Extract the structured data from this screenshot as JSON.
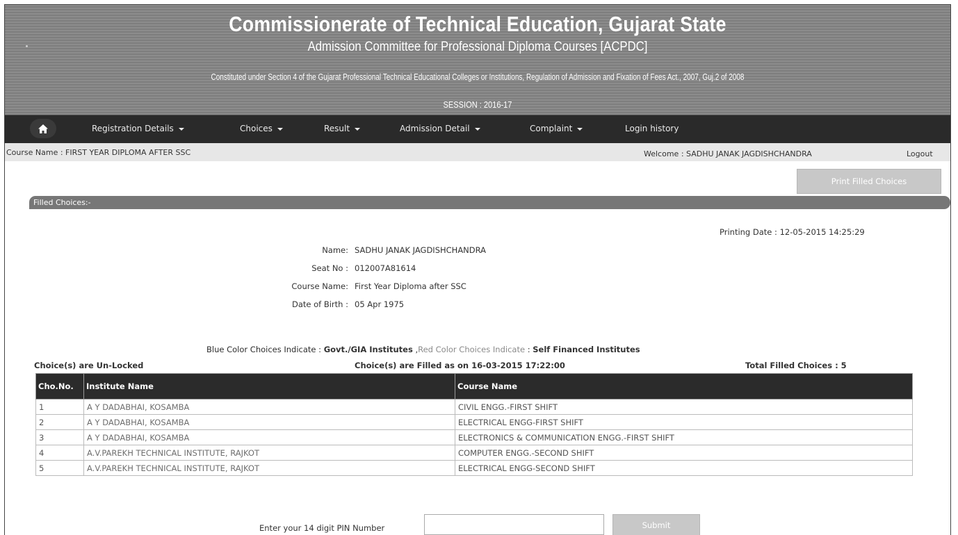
{
  "header": {
    "title": "Commissionerate of Technical Education, Gujarat State",
    "subtitle": "Admission Committee for Professional Diploma Courses [ACPDC]",
    "act": "Constituted under Section 4 of the Gujarat Professional Technical Educational Colleges or Institutions, Regulation of Admission and Fixation of Fees Act., 2007, Guj.2 of 2008",
    "session": "SESSION : 2016-17"
  },
  "nav": {
    "home_icon": "home-icon",
    "items": [
      {
        "label": "Registration Details",
        "dropdown": true
      },
      {
        "label": "Choices",
        "dropdown": true
      },
      {
        "label": "Result",
        "dropdown": true
      },
      {
        "label": "Admission Detail",
        "dropdown": true
      },
      {
        "label": "Complaint",
        "dropdown": true
      },
      {
        "label": "Login history",
        "dropdown": false
      }
    ]
  },
  "infobar": {
    "course": "Course Name : FIRST YEAR DIPLOMA AFTER SSC",
    "welcome": "Welcome : SADHU JANAK JAGDISHCHANDRA",
    "logout": "Logout"
  },
  "print_button": "Print Filled Choices",
  "section_title": "Filled Choices:-",
  "printing_date": "Printing Date : 12-05-2015 14:25:29",
  "candidate": {
    "name_label": "Name:",
    "name": "SADHU JANAK JAGDISHCHANDRA",
    "seat_label": "Seat No :",
    "seat": "012007A81614",
    "course_label": "Course Name:",
    "course": "First Year Diploma after SSC",
    "dob_label": "Date of Birth :",
    "dob": "05 Apr 1975"
  },
  "legend": {
    "blue_text": "Blue Color Choices Indicate",
    "blue_value": "Govt./GIA Institutes",
    "red_text": "Red Color Choices Indicate",
    "red_value": "Self Financed Institutes"
  },
  "status": {
    "locked": "Choice(s) are Un-Locked",
    "filled_on": "Choice(s) are Filled as on 16-03-2015 17:22:00",
    "total": "Total Filled Choices : 5"
  },
  "colors": {
    "header_bg": "#858585",
    "nav_bg": "#2a2a2a",
    "infobar_bg": "#e7e7e7",
    "table_header_bg": "#2b2b2b"
  },
  "table": {
    "columns": [
      "Cho.No.",
      "Institute Name",
      "Course Name"
    ],
    "rows": [
      {
        "no": "1",
        "institute": "A Y DADABHAI, KOSAMBA",
        "course": "CIVIL ENGG.-FIRST SHIFT"
      },
      {
        "no": "2",
        "institute": "A Y DADABHAI, KOSAMBA",
        "course": "ELECTRICAL ENGG-FIRST SHIFT"
      },
      {
        "no": "3",
        "institute": "A Y DADABHAI, KOSAMBA",
        "course": "ELECTRONICS & COMMUNICATION ENGG.-FIRST SHIFT"
      },
      {
        "no": "4",
        "institute": "A.V.PAREKH TECHNICAL INSTITUTE, RAJKOT",
        "course": "COMPUTER ENGG.-SECOND SHIFT"
      },
      {
        "no": "5",
        "institute": "A.V.PAREKH TECHNICAL INSTITUTE, RAJKOT",
        "course": "ELECTRICAL ENGG-SECOND SHIFT"
      }
    ]
  },
  "pin": {
    "label": "Enter your 14 digit PIN Number",
    "value": "",
    "submit": "Submit"
  }
}
